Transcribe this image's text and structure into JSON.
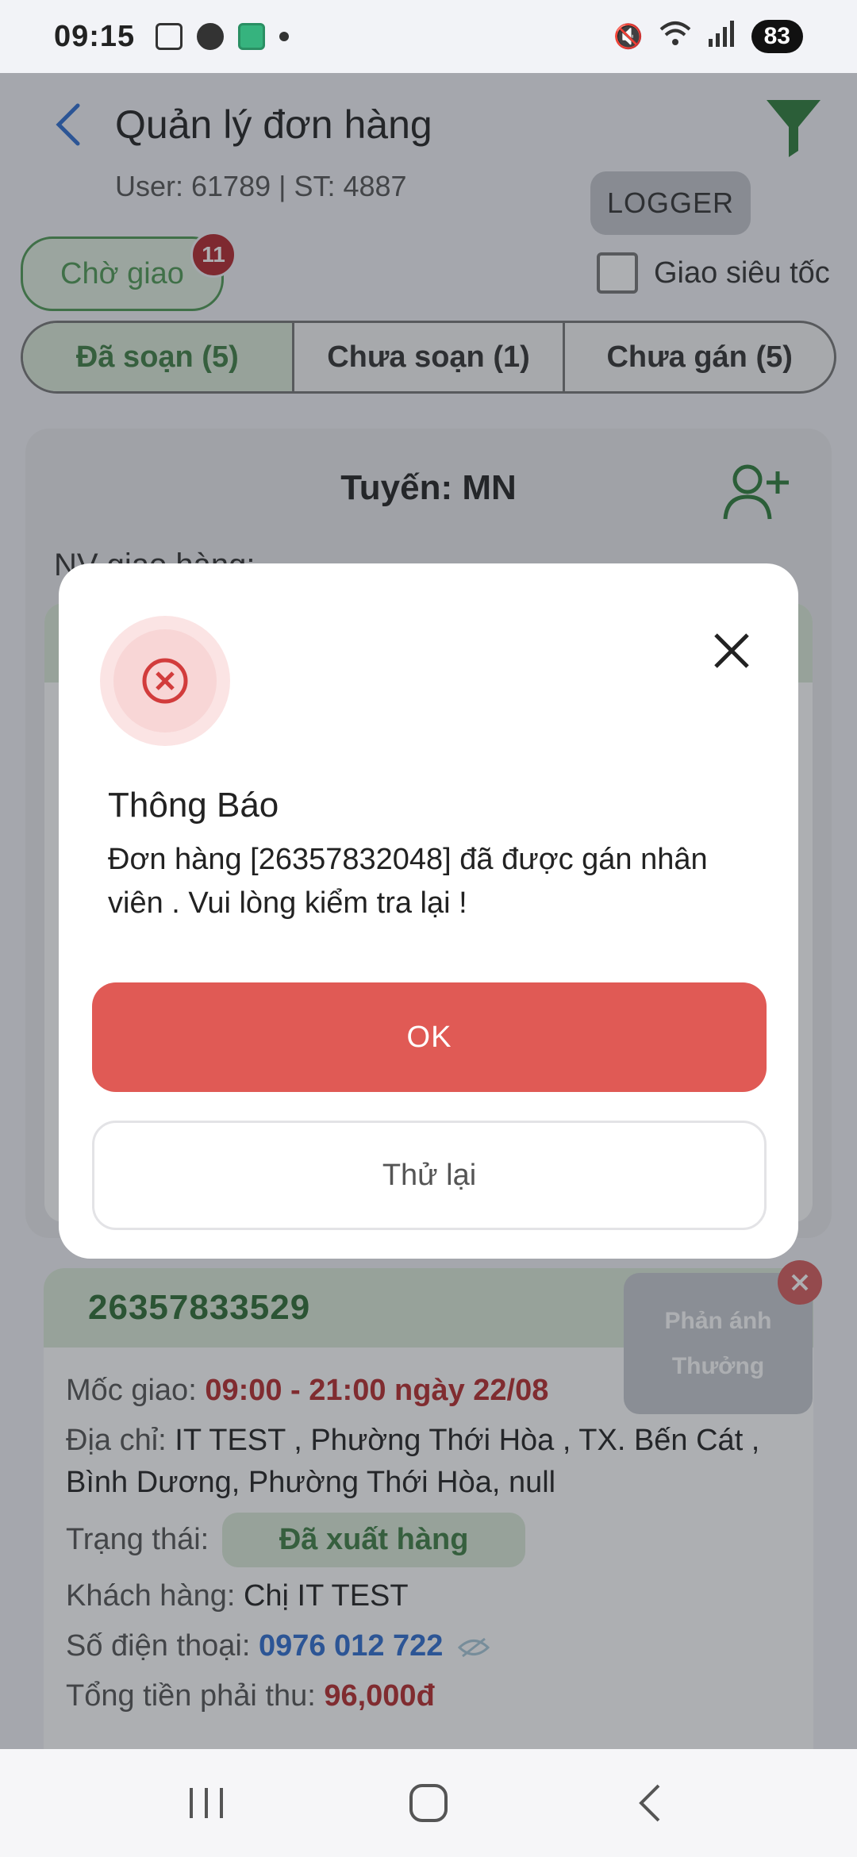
{
  "status_bar": {
    "time": "09:15",
    "battery": "83",
    "icons": [
      "screenshot-icon",
      "line-icon",
      "app-icon",
      "dot-icon",
      "mute-icon",
      "wifi-icon",
      "signal-icon"
    ]
  },
  "header": {
    "title": "Quản lý đơn hàng",
    "user_info": "User: 61789 | ST: 4887",
    "logger_label": "LOGGER"
  },
  "filters": {
    "waiting_label": "Chờ giao",
    "waiting_badge": "11",
    "express_label": "Giao siêu tốc",
    "express_checked": false
  },
  "tabs": [
    {
      "label": "Đã soạn (5)",
      "active": true
    },
    {
      "label": "Chưa soạn (1)",
      "active": false
    },
    {
      "label": "Chưa gán (5)",
      "active": false
    }
  ],
  "route_card": {
    "title": "Tuyến: MN",
    "staff_label": "NV giao hàng:"
  },
  "order": {
    "id": "26357833529",
    "window_label": "Mốc giao:",
    "window_value": "09:00 - 21:00 ngày 22/08",
    "address_label": "Địa chỉ:",
    "address_value": "IT TEST , Phường Thới Hòa , TX. Bến Cát , Bình Dương, Phường Thới Hòa, null",
    "status_label": "Trạng thái:",
    "status_value": "Đã xuất hàng",
    "customer_label": "Khách hàng:",
    "customer_value": "Chị IT TEST",
    "phone_label": "Số điện thoại:",
    "phone_value": "0976 012 722",
    "total_label": "Tổng tiền phải thu:",
    "total_value": "96,000đ"
  },
  "feedback": {
    "line1": "Phản ánh",
    "line2": "Thưởng"
  },
  "dialog": {
    "title": "Thông Báo",
    "message": "Đơn hàng [26357832048] đã được gán nhân viên . Vui lòng kiểm tra lại !",
    "ok_label": "OK",
    "retry_label": "Thử lại"
  },
  "colors": {
    "accent_green": "#3f7f45",
    "danger_red": "#e05a55",
    "badge_red": "#b3282e",
    "phone_blue": "#2f6fd1"
  }
}
